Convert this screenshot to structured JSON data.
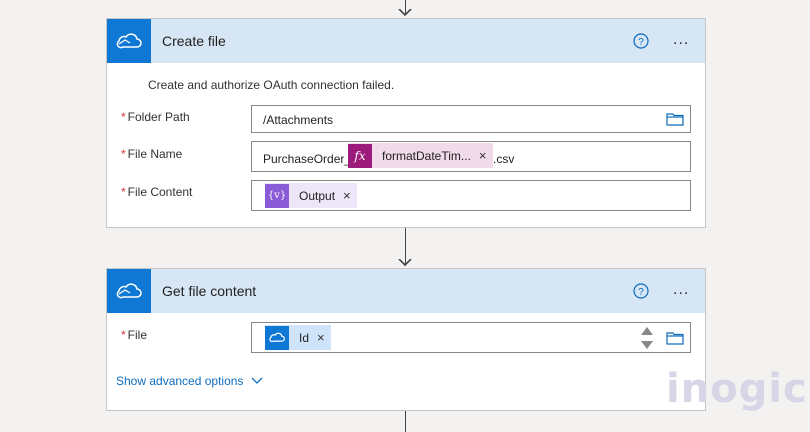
{
  "create_file": {
    "title": "Create file",
    "warning": "Create and authorize OAuth connection failed.",
    "fields": {
      "folder_path": {
        "required": "*",
        "label": "Folder Path",
        "value": "/Attachments"
      },
      "file_name": {
        "required": "*",
        "label": "File Name",
        "prefix": "PurchaseOrder_",
        "token": {
          "icon": "fx",
          "label": "formatDateTim...",
          "close": "×"
        },
        "suffix": ".csv"
      },
      "file_content": {
        "required": "*",
        "label": "File Content",
        "token": {
          "icon": "{v}",
          "label": "Output",
          "close": "×"
        }
      }
    }
  },
  "get_file_content": {
    "title": "Get file content",
    "fields": {
      "file": {
        "required": "*",
        "label": "File",
        "token": {
          "label": "Id",
          "close": "×"
        }
      }
    },
    "advanced_label": "Show advanced options"
  },
  "header": {
    "help_icon": "question-circle-icon",
    "more_label": "..."
  },
  "watermark": "inogic",
  "colors": {
    "header_bg": "#d6e6f5",
    "icon_bg": "#0f78d4",
    "fx_token_bg": "#f1daea",
    "fx_icon_bg": "#9c1a7a",
    "var_token_bg": "#ece6f8",
    "var_icon_bg": "#8a5bd6",
    "onedrive_token_bg": "#cfe4fb",
    "required": "#d13438",
    "link": "#0f6cbd"
  }
}
